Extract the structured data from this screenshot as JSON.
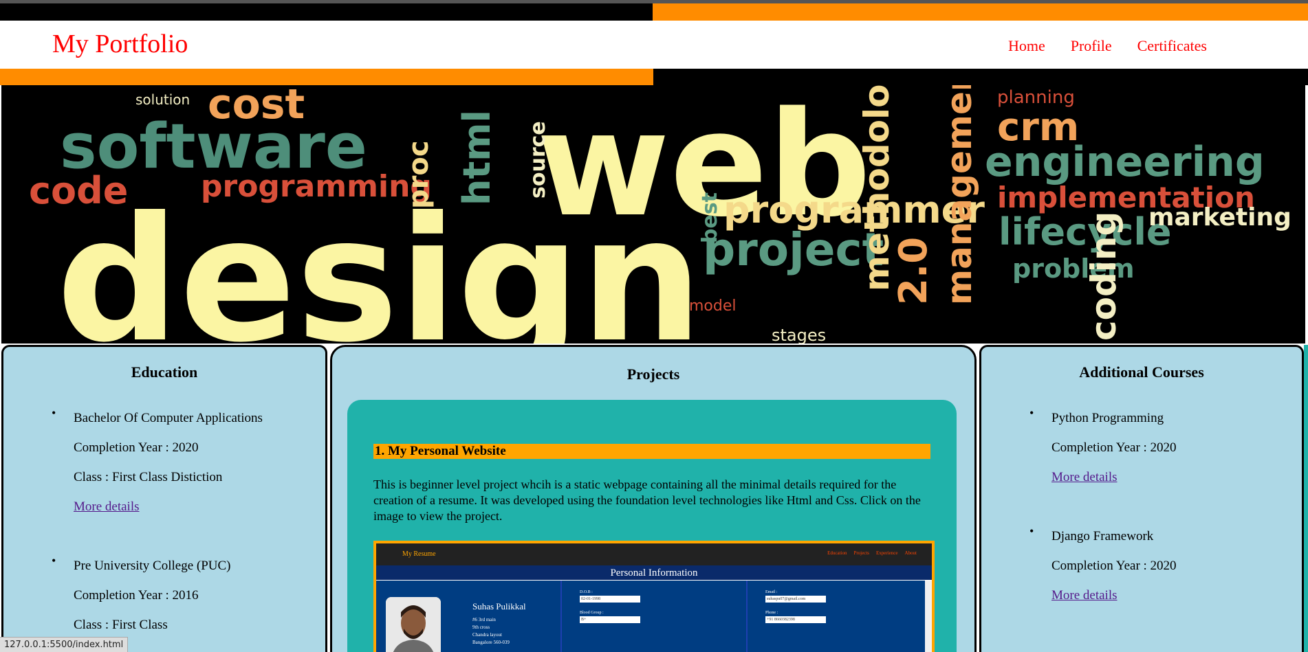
{
  "navbar": {
    "brand": "My Portfolio",
    "links": [
      "Home",
      "Profile",
      "Certificates"
    ]
  },
  "banner": {
    "words": [
      "web",
      "design",
      "software",
      "cost",
      "programming",
      "code",
      "proc",
      "html",
      "source",
      "programmer",
      "project",
      "engineering",
      "implementation",
      "lifecycle",
      "marketing",
      "problem",
      "crm",
      "planning",
      "best",
      "model",
      "stages",
      "coding",
      "management",
      "2.0",
      "methodology"
    ]
  },
  "education": {
    "heading": "Education",
    "items": [
      {
        "title": "Bachelor Of Computer Applications",
        "year": "Completion Year : 2020",
        "class": "Class : First Class Distiction",
        "link": "More details"
      },
      {
        "title": "Pre University College (PUC)",
        "year": "Completion Year : 2016",
        "class": "Class : First Class"
      }
    ]
  },
  "projects": {
    "heading": "Projects",
    "item": {
      "title": "1. My Personal Website",
      "description": "This is beginner level project whcih is a static webpage containing all the minimal details required for the creation of a resume. It was developed using the foundation level technologies like Html and Css. Click on the image to view the project.",
      "preview": {
        "brand": "My Resume",
        "links": [
          "Education",
          "Projects",
          "Experience",
          "About"
        ],
        "heading": "Personal Information",
        "name": "Suhas Pulikkal",
        "address": [
          "#6 3rd main",
          "9th cross",
          "Chandra layout",
          "Bangalore 560-039"
        ],
        "fields": [
          {
            "label": "D.O.B :",
            "value": "02-01-1998"
          },
          {
            "label": "Blood Group :",
            "value": "B+"
          },
          {
            "label": "Email :",
            "value": "suhaspu07@gmail.com"
          },
          {
            "label": "Phone :",
            "value": "+91 8660382398"
          }
        ]
      }
    }
  },
  "courses": {
    "heading": "Additional Courses",
    "items": [
      {
        "title": "Python Programming",
        "year": "Completion Year : 2020",
        "link": "More details"
      },
      {
        "title": "Django Framework",
        "year": "Completion Year : 2020",
        "link": "More details"
      }
    ]
  },
  "statusbar": "127.0.0.1:5500/index.html",
  "colors": {
    "accent": "#ff8c00",
    "nav_text": "#ff0000",
    "panel": "#add8e6",
    "card": "#20b2aa",
    "title_bar": "#ffa500"
  }
}
